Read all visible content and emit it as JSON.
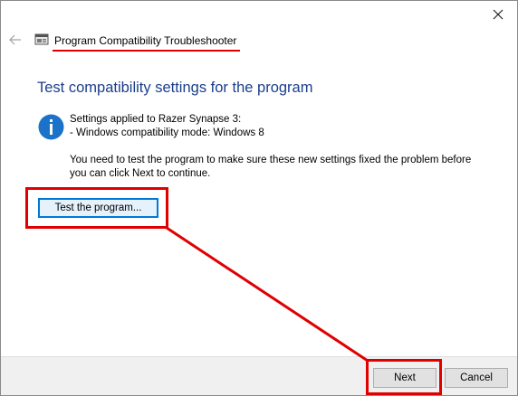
{
  "window": {
    "title": "Program Compatibility Troubleshooter",
    "close_glyph": "✕",
    "back_glyph": "←"
  },
  "main": {
    "heading": "Test compatibility settings for the program",
    "settings": {
      "line1": "Settings applied to Razer Synapse 3:",
      "line2": "- Windows compatibility mode: Windows 8"
    },
    "note": {
      "line1": "You need to test the program to make sure these new settings fixed the problem before",
      "line2": "you can click Next to continue."
    },
    "test_button_label": "Test the program..."
  },
  "footer": {
    "next_label": "Next",
    "cancel_label": "Cancel"
  },
  "icons": {
    "info": "info-icon",
    "app": "troubleshooter-app-icon",
    "back": "back-arrow-icon",
    "close": "close-icon"
  },
  "colors": {
    "heading": "#1a3e8c",
    "info_icon": "#1a73c8",
    "annotation_red": "#e00000",
    "focus_blue": "#0078d7"
  }
}
